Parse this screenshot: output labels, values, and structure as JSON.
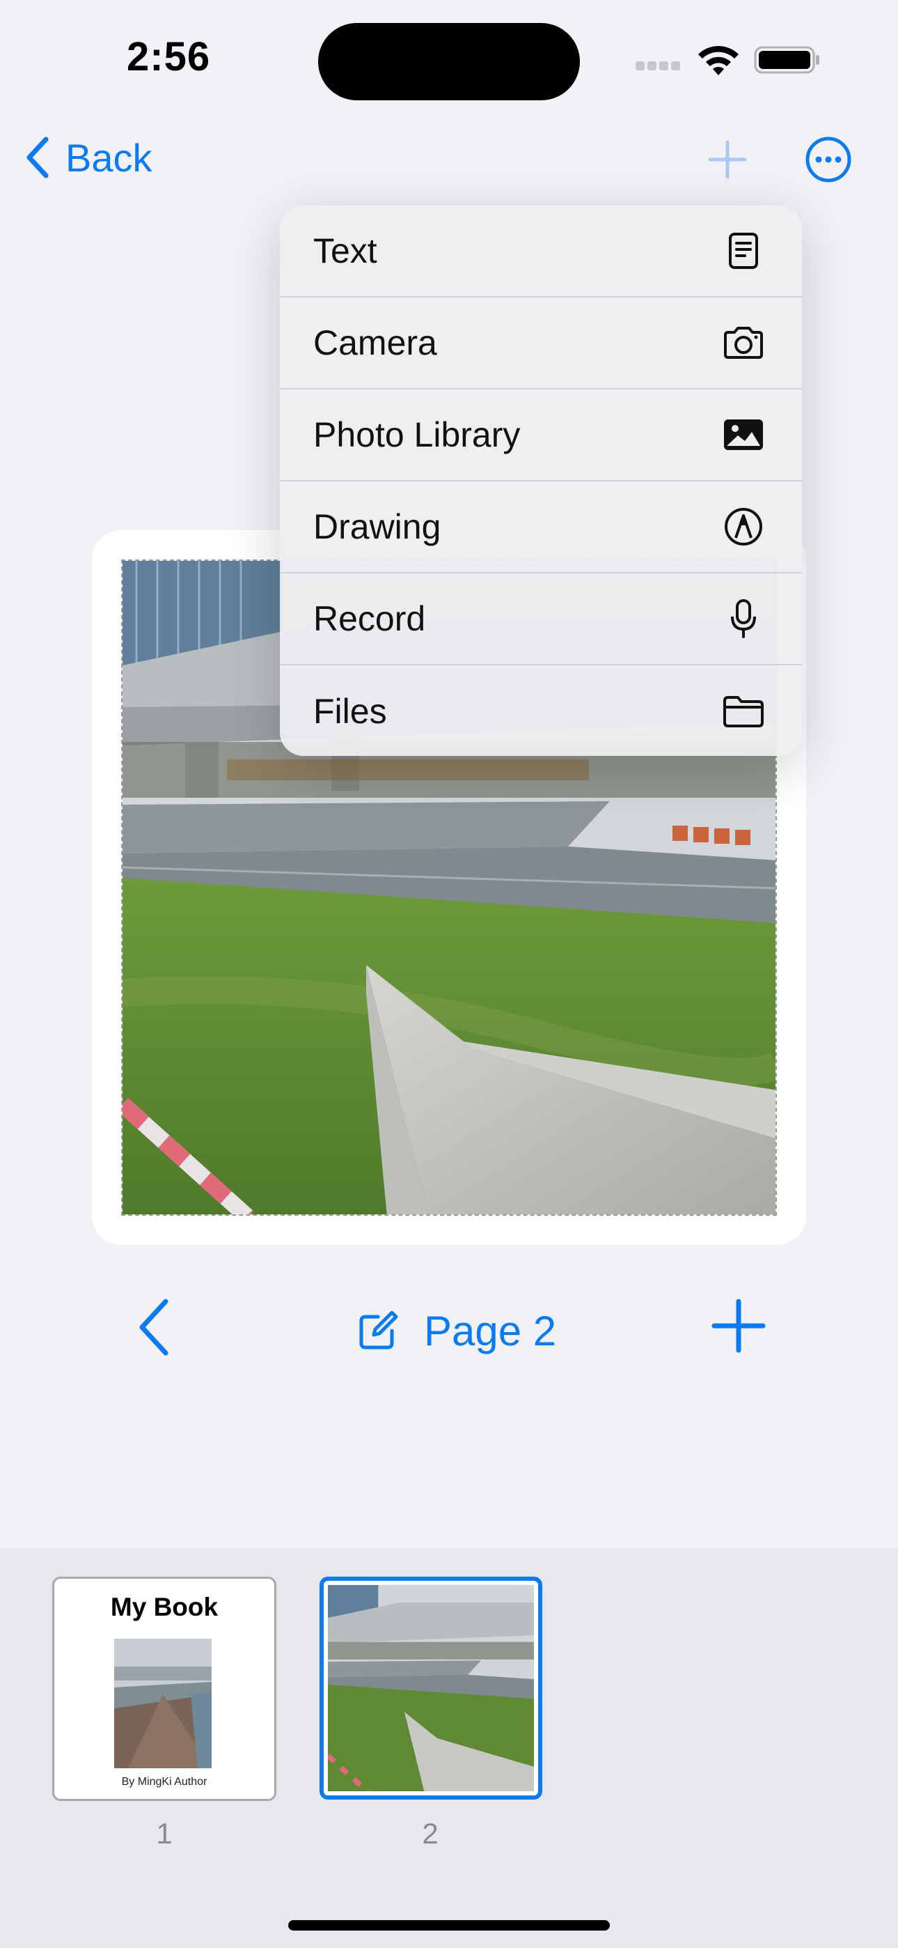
{
  "status_bar": {
    "time": "2:56"
  },
  "nav": {
    "back_label": "Back"
  },
  "add_menu": {
    "items": [
      {
        "label": "Text",
        "icon": "text-document-icon"
      },
      {
        "label": "Camera",
        "icon": "camera-icon"
      },
      {
        "label": "Photo Library",
        "icon": "photo-icon"
      },
      {
        "label": "Drawing",
        "icon": "pen-tip-icon"
      },
      {
        "label": "Record",
        "icon": "microphone-icon"
      },
      {
        "label": "Files",
        "icon": "folder-icon"
      }
    ]
  },
  "page_controls": {
    "page_label": "Page 2"
  },
  "thumbnails": [
    {
      "number": "1",
      "title": "My Book",
      "author": "By MingKi Author"
    },
    {
      "number": "2"
    }
  ],
  "colors": {
    "accent": "#0a7bf0",
    "background": "#f2f1f6",
    "strip": "#e7e7ec"
  }
}
